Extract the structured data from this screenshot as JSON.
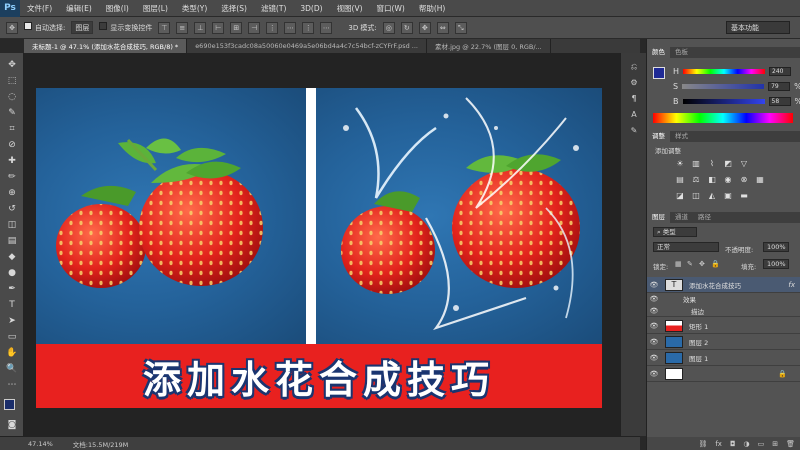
{
  "app": {
    "logo": "Ps"
  },
  "menu": [
    "文件(F)",
    "编辑(E)",
    "图像(I)",
    "图层(L)",
    "类型(Y)",
    "选择(S)",
    "滤镜(T)",
    "3D(D)",
    "视图(V)",
    "窗口(W)",
    "帮助(H)"
  ],
  "options": {
    "auto_select_label": "自动选择:",
    "auto_select_value": "图层",
    "show_transform_label": "显示变换控件",
    "mode_3d_label": "3D 模式:",
    "workspace": "基本功能"
  },
  "tabs": [
    {
      "label": "未标题-1 @ 47.1% (添加水花合成技巧, RGB/8) *",
      "active": true
    },
    {
      "label": "e690e153f3cadc08a50060e0469a5e06bd4a4c7c54bcf-zCYFrF.psd ...",
      "active": false
    },
    {
      "label": "素材.jpg @ 22.7% (图层 0, RGB/...",
      "active": false
    }
  ],
  "canvas": {
    "banner_text": "添加水花合成技巧",
    "banner_color": "#e8211f",
    "outline_color": "#1a3570"
  },
  "status": {
    "zoom": "47.14%",
    "doc": "文档:15.5M/219M"
  },
  "color_panel": {
    "tabs": [
      "颜色",
      "色板"
    ],
    "labels": {
      "h": "H",
      "s": "S",
      "b": "B"
    },
    "h": "240",
    "s": "79",
    "b": "58",
    "pct": "%"
  },
  "adjust_panel": {
    "tabs": [
      "调整",
      "样式"
    ],
    "subtitle": "添加调整"
  },
  "layers_panel": {
    "tabs": [
      "图层",
      "通道",
      "路径"
    ],
    "filter_label": "类型",
    "blend_mode": "正常",
    "opacity_label": "不透明度:",
    "opacity": "100%",
    "lock_label": "锁定:",
    "fill_label": "填充:",
    "fill": "100%",
    "fx_label": "fx",
    "layers": [
      {
        "name": "添加水花合成技巧",
        "kind": "text"
      },
      {
        "name": "效果",
        "kind": "effect"
      },
      {
        "name": "描边",
        "kind": "effect"
      },
      {
        "name": "矩形 1",
        "kind": "shape"
      },
      {
        "name": "图层 2",
        "kind": "image"
      },
      {
        "name": "图层 1",
        "kind": "image"
      },
      {
        "name": "",
        "kind": "background"
      }
    ]
  }
}
